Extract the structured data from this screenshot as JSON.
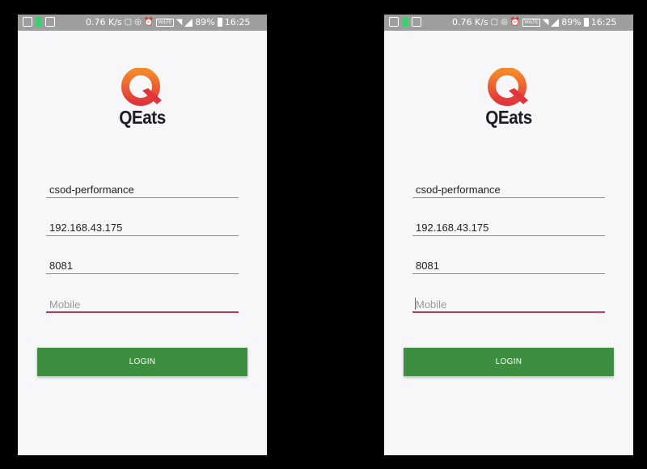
{
  "status_bar": {
    "speed": "0.76 K/s",
    "network_badge": "VoLTE",
    "battery": "89%",
    "time": "16:25",
    "icons": [
      "gallery-icon",
      "battery-saver-icon",
      "image-icon",
      "cast-icon",
      "hotspot-icon",
      "alarm-icon",
      "volte-icon",
      "wifi-icon",
      "signal-icon",
      "battery-icon"
    ]
  },
  "app": {
    "name": "QEats",
    "logo_colors": [
      "#f05a28",
      "#e0363b"
    ]
  },
  "form": {
    "username": "csod-performance",
    "ip_address": "192.168.43.175",
    "port": "8081",
    "mobile_placeholder": "Mobile",
    "login_label": "LOGIN"
  },
  "colors": {
    "login_button": "#3e8e41",
    "focus_underline": "#c2395a"
  }
}
